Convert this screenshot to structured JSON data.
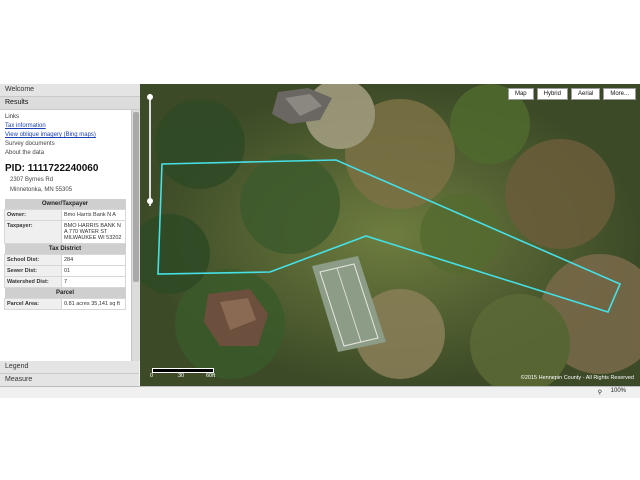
{
  "sidebar": {
    "tabs_top": [
      "Welcome",
      "Results"
    ],
    "links_title": "Links",
    "links": [
      "Tax information",
      "View oblique imagery (Bing maps)",
      "Survey documents",
      "About the data"
    ],
    "pid": "PID: 1111722240060",
    "address_line1": "2307 Byrnes Rd",
    "address_line2": "Minnetonka, MN 55305",
    "owner_section": "Owner/Taxpayer",
    "owner_label": "Owner:",
    "owner_value": "Bmo Harris Bank N A",
    "taxpayer_label": "Taxpayer:",
    "taxpayer_value": "BMO HARRIS BANK N A 770 WATER ST MILWAUKEE WI 53202",
    "tax_section": "Tax District",
    "school_label": "School Dist:",
    "school_value": "284",
    "sewer_label": "Sewer Dist:",
    "sewer_value": "01",
    "watershed_label": "Watershed Dist:",
    "watershed_value": "7",
    "parcel_section": "Parcel",
    "area_label": "Parcel Area:",
    "area_value": "0.81 acres 35,141 sq ft",
    "tabs_bottom": [
      "Legend",
      "Measure"
    ]
  },
  "map": {
    "buttons": [
      "Map",
      "Hybrid",
      "Aerial",
      "More..."
    ],
    "scale_labels": [
      "0",
      "30",
      "60ft"
    ],
    "copyright": "©2015 Hennepin County - All Rights Reserved",
    "parcel_color": "#46e0e6"
  },
  "status": {
    "zoom": "100%"
  }
}
